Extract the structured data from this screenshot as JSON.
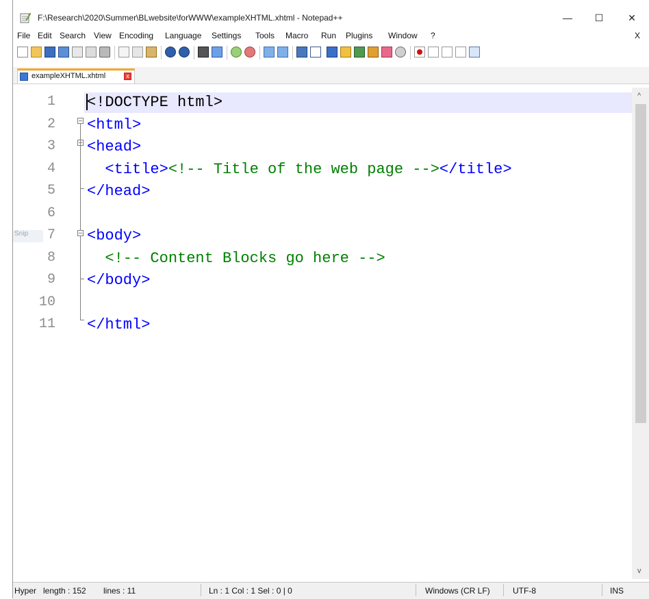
{
  "window": {
    "title": "F:\\Research\\2020\\Summer\\BLwebsite\\forWWW\\exampleXHTML.xhtml - Notepad++",
    "controls": {
      "minimize": "—",
      "maximize": "☐",
      "close": "✕"
    }
  },
  "menu": {
    "items": [
      "File",
      "Edit",
      "Search",
      "View",
      "Encoding",
      "Language",
      "Settings",
      "Tools",
      "Macro",
      "Run",
      "Plugins",
      "Window",
      "?"
    ],
    "close_label": "X"
  },
  "toolbar": {
    "icons": [
      "new-file-icon",
      "open-file-icon",
      "save-icon",
      "save-all-icon",
      "close-icon",
      "close-all-icon",
      "print-icon",
      "cut-icon",
      "copy-icon",
      "paste-icon",
      "undo-icon",
      "redo-icon",
      "find-icon",
      "replace-icon",
      "zoom-in-icon",
      "zoom-out-icon",
      "sync-vertical-icon",
      "sync-horizontal-icon",
      "word-wrap-icon",
      "show-all-chars-icon",
      "indent-guide-icon",
      "user-language-icon",
      "doc-map-icon",
      "function-list-icon",
      "folder-workspace-icon",
      "monitoring-icon",
      "record-macro-icon",
      "stop-macro-icon",
      "play-macro-icon",
      "run-macro-multiple-icon",
      "save-macro-icon"
    ]
  },
  "tab": {
    "label": "exampleXHTML.xhtml",
    "close": "x"
  },
  "editor": {
    "side_label": "Snip",
    "lines": [
      {
        "num": "1",
        "parts": [
          {
            "t": "<!DOCTYPE html>",
            "c": "plain"
          }
        ]
      },
      {
        "num": "2",
        "parts": [
          {
            "t": "<html>",
            "c": "tag"
          }
        ]
      },
      {
        "num": "3",
        "parts": [
          {
            "t": "<head>",
            "c": "tag"
          }
        ]
      },
      {
        "num": "4",
        "parts": [
          {
            "t": "  <title>",
            "c": "tag"
          },
          {
            "t": "<!-- Title of the web page -->",
            "c": "comment"
          },
          {
            "t": "</title>",
            "c": "tag"
          }
        ]
      },
      {
        "num": "5",
        "parts": [
          {
            "t": "</head>",
            "c": "tag"
          }
        ]
      },
      {
        "num": "6",
        "parts": []
      },
      {
        "num": "7",
        "parts": [
          {
            "t": "<body>",
            "c": "tag"
          }
        ]
      },
      {
        "num": "8",
        "parts": [
          {
            "t": "  <!-- Content Blocks go here -->",
            "c": "comment"
          }
        ]
      },
      {
        "num": "9",
        "parts": [
          {
            "t": "</body>",
            "c": "tag"
          }
        ]
      },
      {
        "num": "10",
        "parts": []
      },
      {
        "num": "11",
        "parts": [
          {
            "t": "</html>",
            "c": "tag"
          }
        ]
      }
    ]
  },
  "status": {
    "type": "Hyper",
    "length": "length : 152",
    "lines": "lines : 11",
    "position": "Ln : 1    Col : 1    Sel : 0 | 0",
    "eol": "Windows (CR LF)",
    "encoding": "UTF-8",
    "mode": "INS"
  },
  "colors": {
    "tag": "#0000ff",
    "comment": "#008000",
    "current_line": "#e8e8ff",
    "tab_accent": "#f5a623"
  }
}
